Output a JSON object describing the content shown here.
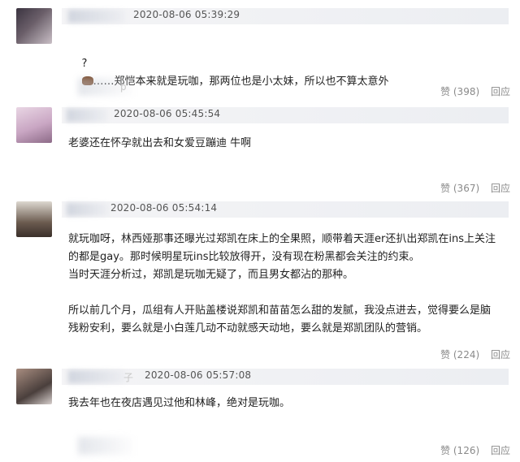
{
  "comments": [
    {
      "timestamp": "2020-08-06 05:39:29",
      "text_prefix": "?",
      "text": "……郑恺本来就是玩咖，那两位也是小太妹，所以也不算太意外",
      "subname_fragment": "p",
      "likes": "赞 (398)",
      "reply": "回应"
    },
    {
      "timestamp": "2020-08-06 05:45:54",
      "text": "老婆还在怀孕就出去和女爱豆蹦迪 牛啊",
      "likes": "赞 (367)",
      "reply": "回应"
    },
    {
      "timestamp": "2020-08-06 05:54:14",
      "text": "就玩咖呀，林西娅那事还曝光过郑凯在床上的全果照，顺带着天涯er还扒出郑凯在ins上关注的都是gay。那时候明星玩ins比较放得开，没有现在粉黑都会关注的约束。\n当时天涯分析过，郑凯是玩咖无疑了，而且男女都沾的那种。\n\n所以前几个月，瓜组有人开贴盖楼说郑凯和苗苗怎么甜的发腻，我没点进去，觉得要么是脑残粉安利，要么就是小白莲几动不动就感天动地，要么就是郑凯团队的营销。",
      "likes": "赞 (224)",
      "reply": "回应"
    },
    {
      "timestamp": "2020-08-06 05:57:08",
      "name_fragment": "子",
      "text": "我去年也在夜店遇见过他和林峰，绝对是玩咖。",
      "likes": "赞 (126)",
      "reply": "回应"
    }
  ]
}
